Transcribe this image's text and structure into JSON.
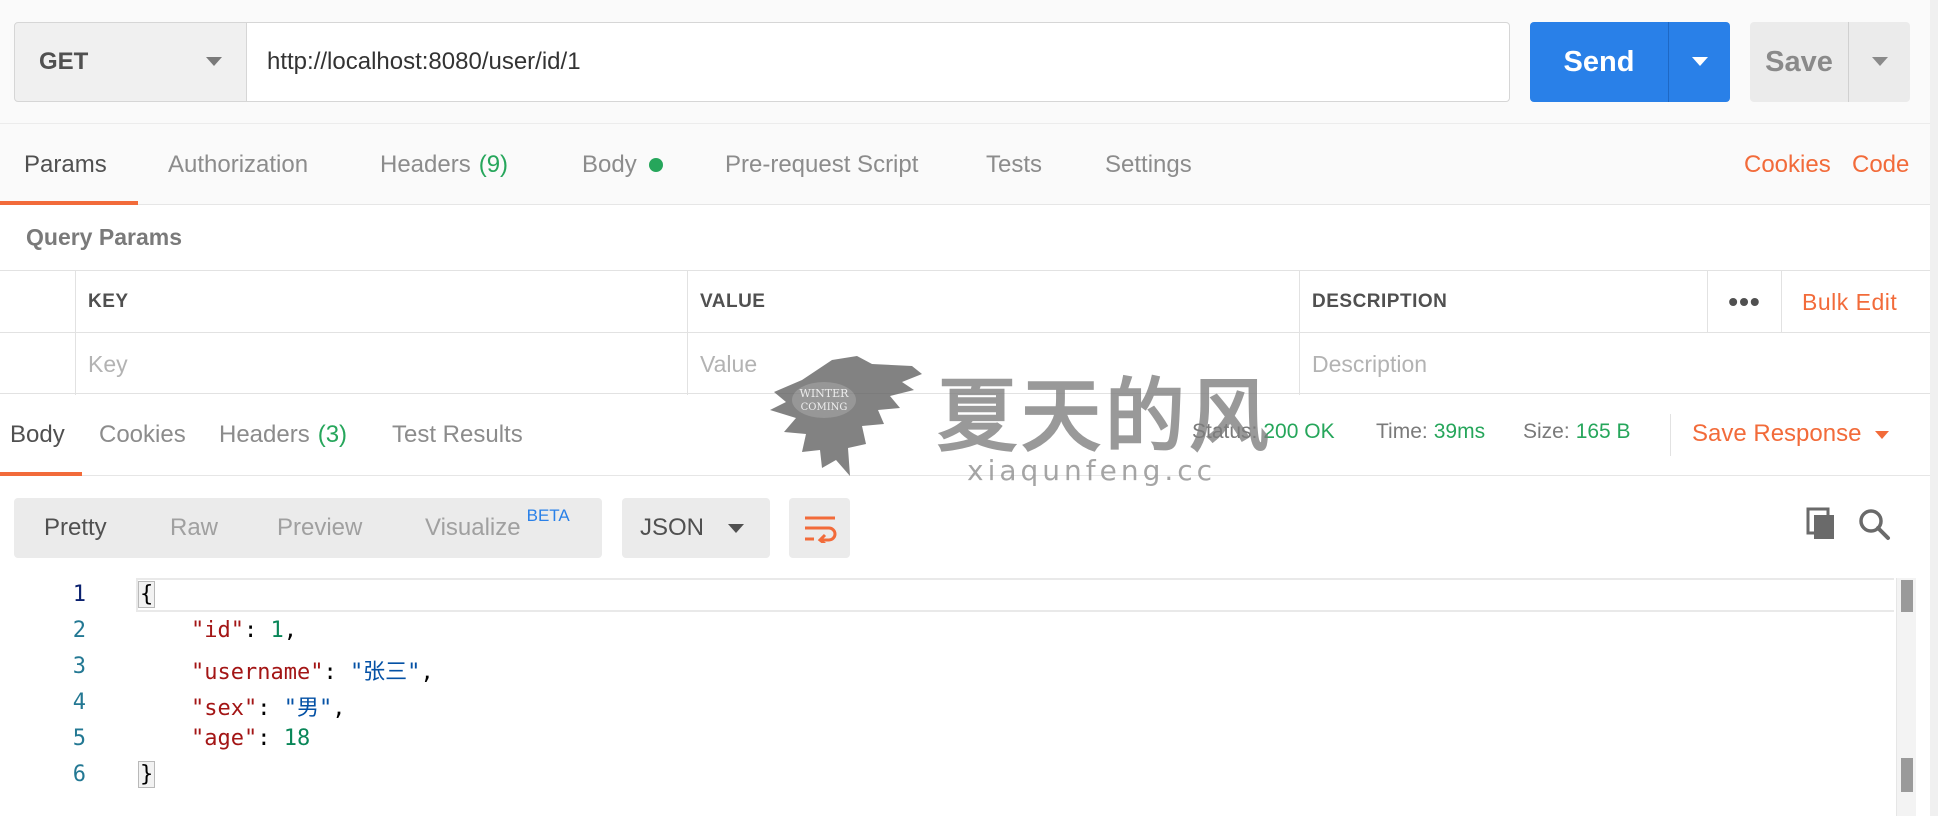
{
  "request": {
    "method": "GET",
    "url": "http://localhost:8080/user/id/1",
    "send_label": "Send",
    "save_label": "Save"
  },
  "request_tabs": {
    "params": "Params",
    "authorization": "Authorization",
    "headers": "Headers",
    "headers_count": "(9)",
    "body": "Body",
    "pre_request": "Pre-request Script",
    "tests": "Tests",
    "settings": "Settings",
    "cookies": "Cookies",
    "code": "Code"
  },
  "query_params": {
    "title": "Query Params",
    "columns": {
      "key": "KEY",
      "value": "VALUE",
      "description": "DESCRIPTION"
    },
    "more": "•••",
    "bulk_edit": "Bulk Edit",
    "placeholders": {
      "key": "Key",
      "value": "Value",
      "description": "Description"
    }
  },
  "response_tabs": {
    "body": "Body",
    "cookies": "Cookies",
    "headers": "Headers",
    "headers_count": "(3)",
    "test_results": "Test Results"
  },
  "response_status": {
    "status_label": "Status:",
    "status_value": "200 OK",
    "time_label": "Time:",
    "time_value": "39ms",
    "size_label": "Size:",
    "size_value": "165 B",
    "save_response": "Save Response"
  },
  "response_view": {
    "options": {
      "pretty": "Pretty",
      "raw": "Raw",
      "preview": "Preview",
      "visualize": "Visualize"
    },
    "beta": "BETA",
    "format": "JSON"
  },
  "response_body": {
    "line_numbers": [
      "1",
      "2",
      "3",
      "4",
      "5",
      "6"
    ],
    "open_brace": "{",
    "close_brace": "}",
    "fields": [
      {
        "key": "\"id\"",
        "value": "1",
        "value_type": "number",
        "trailing": ","
      },
      {
        "key": "\"username\"",
        "value": "\"张三\"",
        "value_type": "string",
        "trailing": ","
      },
      {
        "key": "\"sex\"",
        "value": "\"男\"",
        "value_type": "string",
        "trailing": ","
      },
      {
        "key": "\"age\"",
        "value": "18",
        "value_type": "number",
        "trailing": ""
      }
    ]
  },
  "watermark": {
    "title": "夏天的风",
    "url": "xiaqunfeng.cc",
    "emblem_text": "WINTER IS COMING"
  },
  "icons": {
    "method_dropdown": "chevron-down-icon",
    "wrap": "wrap-lines-icon",
    "copy": "copy-icon",
    "search": "search-icon"
  },
  "colors": {
    "accent": "#f26b3a",
    "primary": "#2980e8",
    "success": "#26a65b"
  }
}
